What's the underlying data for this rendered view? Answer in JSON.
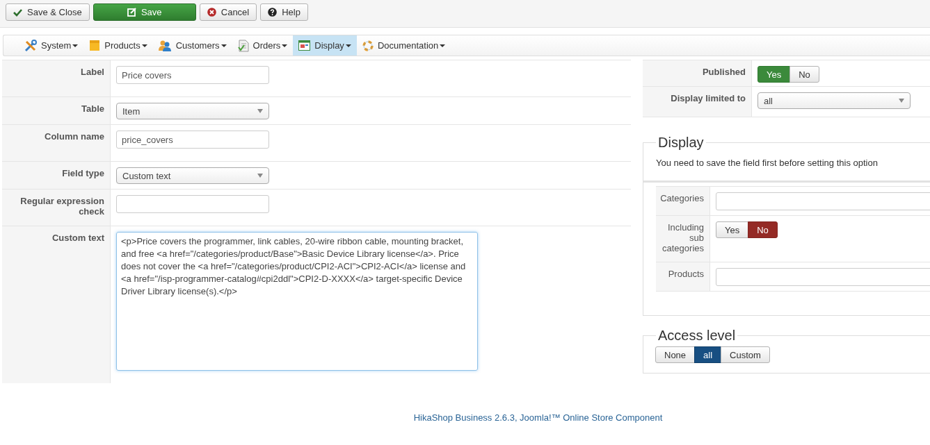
{
  "toolbar": {
    "buttons": [
      {
        "label": "Save & Close",
        "kind": "save-close"
      },
      {
        "label": "Save",
        "kind": "save"
      },
      {
        "label": "Cancel",
        "kind": "cancel"
      },
      {
        "label": "Help",
        "kind": "help"
      }
    ]
  },
  "menu": {
    "items": [
      {
        "label": "System",
        "kind": "system",
        "selected": false
      },
      {
        "label": "Products",
        "kind": "products",
        "selected": false
      },
      {
        "label": "Customers",
        "kind": "customers",
        "selected": false
      },
      {
        "label": "Orders",
        "kind": "orders",
        "selected": false
      },
      {
        "label": "Display",
        "kind": "display",
        "selected": true
      },
      {
        "label": "Documentation",
        "kind": "documentation",
        "selected": false
      }
    ]
  },
  "form": {
    "fields": [
      {
        "label": "Label",
        "kind": "text",
        "value": "Price covers"
      },
      {
        "label": "Table",
        "kind": "select",
        "value": "Item"
      },
      {
        "label": "Column name",
        "kind": "text",
        "value": "price_covers"
      },
      {
        "label": "Field type",
        "kind": "select",
        "value": "Custom text"
      },
      {
        "label": "Regular expression check",
        "kind": "text"
      },
      {
        "label": "Custom text",
        "kind": "textarea",
        "value": "<p>Price covers the programmer, link cables, 20-wire ribbon cable, mounting bracket, and free <a href=\"/categories/product/Base\">Basic Device Library license</a>. Price does not cover the <a href=\"/categories/product/CPI2-ACI\">CPI2-ACI</a> license and <a href=\"/isp-programmer-catalog#cpi2ddl\">CPI2-D-XXXX</a> target-specific Device Driver Library license(s).</p>"
      }
    ]
  },
  "options": {
    "fields": [
      {
        "label": "Published",
        "kind": "toggle",
        "options": [
          {
            "label": "Yes",
            "kind": "yes",
            "selected": true
          },
          {
            "label": "No",
            "kind": "no",
            "selected": false
          }
        ]
      },
      {
        "label": "Display limited to",
        "kind": "select",
        "value": "all"
      }
    ]
  },
  "display": {
    "title": "Display",
    "note": "You need to save the field first before setting this option",
    "fields": [
      {
        "label": "Categories",
        "kind": "text"
      },
      {
        "label": "Including sub categories",
        "kind": "toggle",
        "options": [
          {
            "label": "Yes",
            "kind": "yes",
            "selected": false
          },
          {
            "label": "No",
            "kind": "no",
            "selected": true
          }
        ]
      },
      {
        "label": "Products",
        "kind": "text"
      }
    ]
  },
  "access": {
    "title": "Access level",
    "options": [
      {
        "label": "None",
        "selected": false
      },
      {
        "label": "all",
        "selected": true
      },
      {
        "label": "Custom",
        "selected": false
      }
    ]
  },
  "footer": {
    "text": "HikaShop Business 2.6.3, Joomla!™ Online Store Component"
  }
}
